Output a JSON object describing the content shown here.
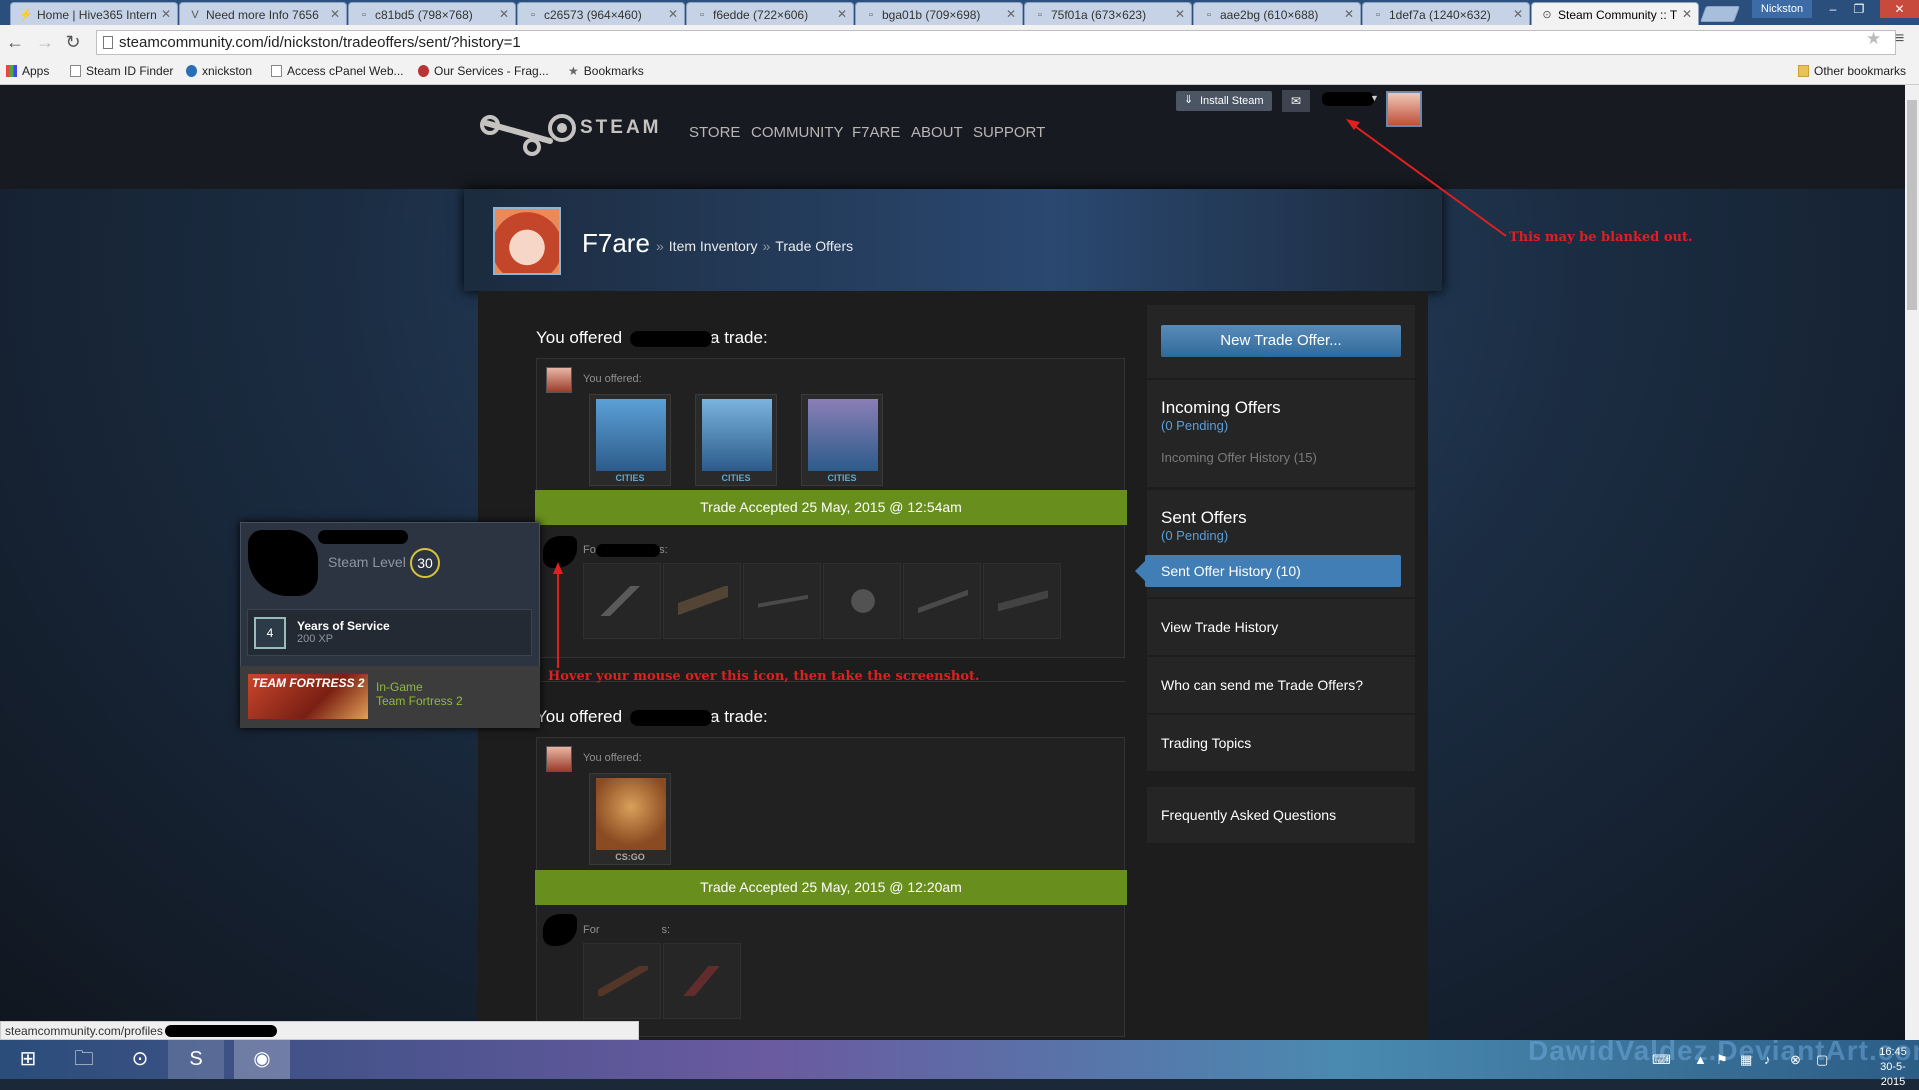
{
  "browser": {
    "tabs": [
      {
        "title": "Home | Hive365 Intern",
        "icon": "hive-icon"
      },
      {
        "title": "Need more Info 7656",
        "icon": "v-icon"
      },
      {
        "title": "c81bd5 (798×768)",
        "icon": "image-icon"
      },
      {
        "title": "c26573 (964×460)",
        "icon": "image-icon"
      },
      {
        "title": "f6edde (722×606)",
        "icon": "image-icon"
      },
      {
        "title": "bga01b (709×698)",
        "icon": "image-icon"
      },
      {
        "title": "75f01a (673×623)",
        "icon": "image-icon"
      },
      {
        "title": "aae2bg (610×688)",
        "icon": "image-icon"
      },
      {
        "title": "1def7a (1240×632)",
        "icon": "image-icon"
      },
      {
        "title": "Steam Community :: T",
        "icon": "steam-icon"
      }
    ],
    "profile_name": "Nickston",
    "url": "steamcommunity.com/id/nickston/tradeoffers/sent/?history=1",
    "bookmarks": [
      "Apps",
      "Steam ID Finder",
      "xnickston",
      "Access cPanel Web...",
      "Our Services - Frag...",
      "Bookmarks"
    ],
    "other_bookmarks": "Other bookmarks"
  },
  "steam": {
    "logo_text": "STEAM",
    "nav": [
      "STORE",
      "COMMUNITY",
      "F7ARE",
      "ABOUT",
      "SUPPORT"
    ],
    "install_label": "Install Steam"
  },
  "profile": {
    "name": "F7are",
    "breadcrumb": [
      "Item Inventory",
      "Trade Offers"
    ],
    "separator": "»"
  },
  "offers": [
    {
      "title_pre": "You offered",
      "title_post": "a trade:",
      "you_offered_label": "You offered:",
      "items": [
        {
          "name": "cities-van-card",
          "caption": "CITIES"
        },
        {
          "name": "cities-rocket-card",
          "caption": "CITIES"
        },
        {
          "name": "cities-rocket-card-2",
          "caption": "CITIES"
        }
      ],
      "status": "Trade Accepted 25 May, 2015 @ 12:54am",
      "for_label_pre": "For T",
      "for_label_post": "s:"
    },
    {
      "title_pre": "You offered",
      "title_post": "a trade:",
      "you_offered_label": "You offered:",
      "items": [
        {
          "name": "csgo-case",
          "caption": "CS:GO"
        }
      ],
      "status": "Trade Accepted 25 May, 2015 @ 12:20am",
      "for_label_pre": "For",
      "for_label_post": "s:"
    }
  ],
  "sidebar": {
    "new_trade": "New Trade Offer...",
    "incoming_title": "Incoming Offers",
    "incoming_pending": "(0 Pending)",
    "incoming_history": "Incoming Offer History (15)",
    "sent_title": "Sent Offers",
    "sent_pending": "(0 Pending)",
    "sent_history": "Sent Offer History (10)",
    "view_history": "View Trade History",
    "who_can": "Who can send me Trade Offers?",
    "topics": "Trading Topics",
    "faq": "Frequently Asked Questions"
  },
  "hover_card": {
    "level_label": "Steam Level",
    "level": "30",
    "badge_number": "4",
    "badge_title": "Years of Service",
    "badge_xp": "200 XP",
    "game_art_text": "TEAM FORTRESS 2",
    "status": "In-Game",
    "game": "Team Fortress 2"
  },
  "annotations": {
    "blank_note": "This may be blanked out.",
    "hover_note": "Hover your mouse over this icon, then take the screenshot.",
    "color": "#e01f1f"
  },
  "status_bar": "steamcommunity.com/profiles",
  "taskbar": {
    "time": "16:45",
    "date": "30-5-2015",
    "watermark": "DawidValdez.DeviantArt.com"
  },
  "colors": {
    "accept_green": "#688f1d",
    "steam_blue": "#417eb6",
    "pending_blue": "#5a9fd9"
  }
}
